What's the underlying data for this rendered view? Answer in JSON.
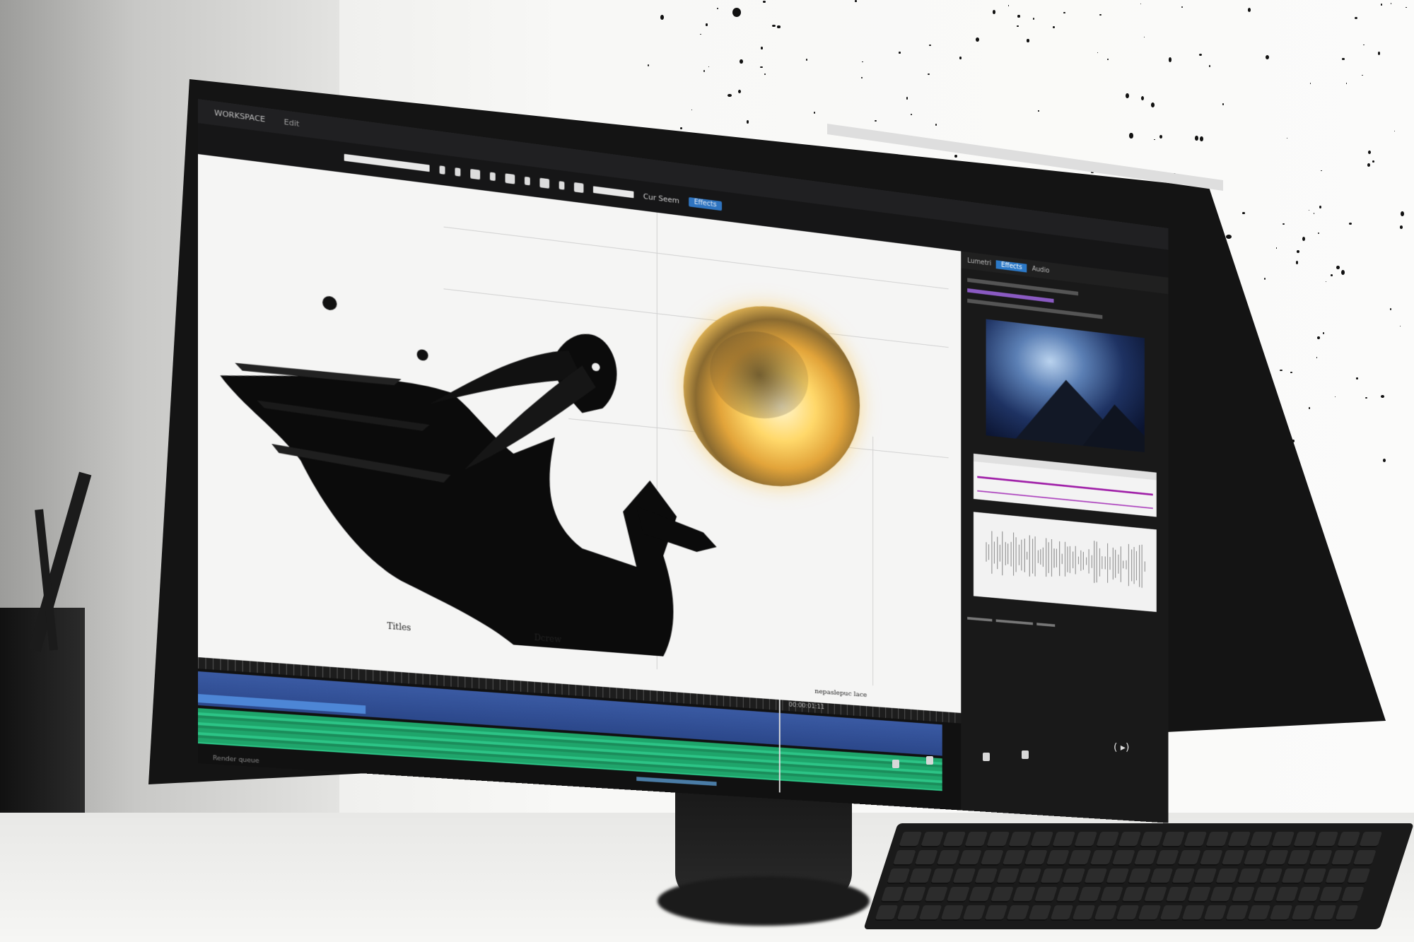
{
  "app": {
    "title": "WORKSPACE",
    "menu_left": "Edit",
    "search_label": "Cur Seem",
    "panel_tab_active": "Effects"
  },
  "canvas": {
    "caption_bottom": "Titles",
    "caption_bottom_2": "Dcrew",
    "caption_right": "nepaslepuc lace"
  },
  "timeline": {
    "timecode": "00:00:01:11"
  },
  "panel": {
    "tabs": [
      "Lumetri",
      "Effects",
      "Audio"
    ]
  },
  "status": {
    "text": "Render queue"
  },
  "colors": {
    "accent_blue": "#2f74c0",
    "track_video": "#3a5aa3",
    "track_audio": "#1fa56b",
    "scope_magenta": "#a020a8",
    "orb_gold": "#ffd86a"
  },
  "icons": {
    "play": "play-icon",
    "monitor_power": "power-icon"
  }
}
